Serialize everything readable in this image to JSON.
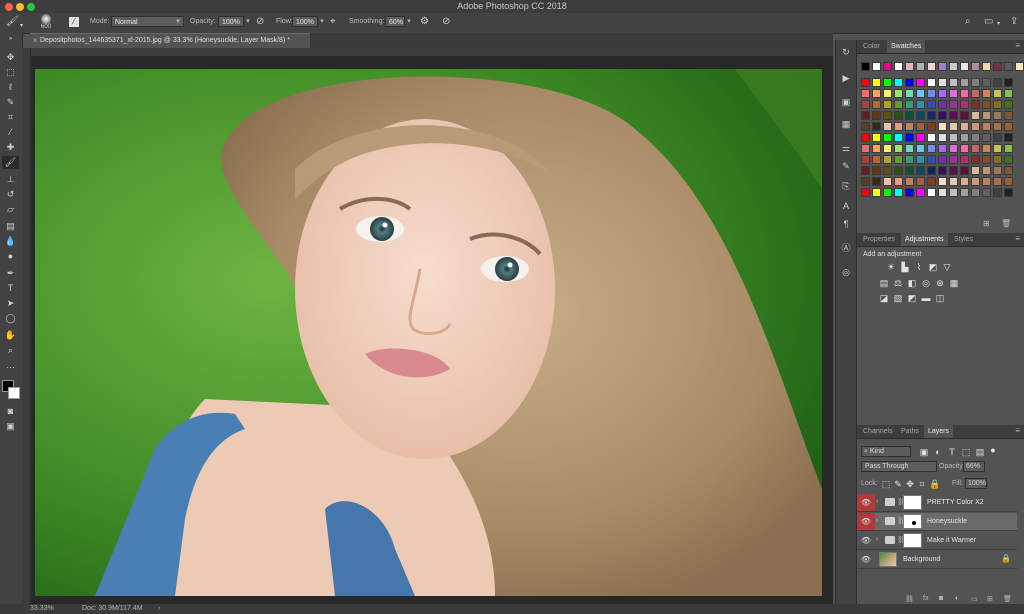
{
  "app": {
    "title": "Adobe Photoshop CC 2018"
  },
  "options_bar": {
    "brush_size": "600",
    "mode_label": "Mode:",
    "mode_value": "Normal",
    "opacity_label": "Opacity:",
    "opacity_value": "100%",
    "flow_label": "Flow:",
    "flow_value": "100%",
    "smoothing_label": "Smoothing:",
    "smoothing_value": "60%"
  },
  "document": {
    "tab_title": "Depositphotos_144635371_xl-2015.jpg @ 33.3% (Honeysuckle, Layer Mask/8) *"
  },
  "status": {
    "zoom": "33.33%",
    "doc_size": "Doc: 30.9M/117.4M"
  },
  "color_panel": {
    "tabs": [
      "Color",
      "Swatches"
    ],
    "active_tab": "Swatches"
  },
  "adjustments_panel": {
    "tabs": [
      "Properties",
      "Adjustments",
      "Styles"
    ],
    "active_tab": "Adjustments",
    "heading": "Add an adjustment"
  },
  "layers_panel": {
    "tabs": [
      "Channels",
      "Paths",
      "Layers"
    ],
    "active_tab": "Layers",
    "filter_kind": "Kind",
    "blend_mode": "Pass Through",
    "opacity_label": "Opacity:",
    "opacity_value": "66%",
    "lock_label": "Lock:",
    "fill_label": "Fill:",
    "fill_value": "100%",
    "layers": [
      {
        "name": "PRETTY Color X2",
        "visible": true,
        "highlight_eye": true,
        "selected": false
      },
      {
        "name": "Honeysuckle",
        "visible": true,
        "highlight_eye": true,
        "selected": true
      },
      {
        "name": "Make it Warmer",
        "visible": true,
        "highlight_eye": false,
        "selected": false
      },
      {
        "name": "Background",
        "visible": true,
        "highlight_eye": false,
        "selected": false,
        "locked": true
      }
    ]
  },
  "colors": {
    "accent_eye": "#b03a3a",
    "panel_bg": "#535353",
    "selected_row": "#6a6a6a"
  },
  "icons": {
    "tools": [
      "move-icon",
      "marquee-icon",
      "lasso-icon",
      "quick-select-icon",
      "crop-icon",
      "eyedropper-icon",
      "healing-icon",
      "brush-icon",
      "stamp-icon",
      "history-brush-icon",
      "eraser-icon",
      "gradient-icon",
      "blur-icon",
      "dodge-icon",
      "pen-icon",
      "type-icon",
      "path-select-icon",
      "shape-icon",
      "hand-icon",
      "zoom-icon",
      "more-tools-icon"
    ]
  }
}
